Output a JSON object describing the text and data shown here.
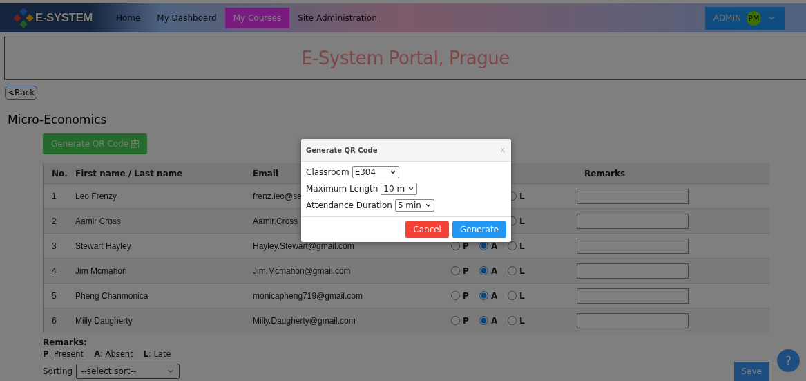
{
  "nav": {
    "logo": "E-SYSTEM",
    "items": [
      {
        "label": "Home",
        "selected": false
      },
      {
        "label": "My Dashboard",
        "selected": false
      },
      {
        "label": "My Courses",
        "selected": true
      },
      {
        "label": "Site Administration",
        "selected": false
      }
    ],
    "user": {
      "label": "ADMIN",
      "initials": "PM"
    }
  },
  "banner": {
    "title": "E-System Portal, Prague"
  },
  "back_button": "<Back",
  "course": {
    "title": "Micro-Economics",
    "qr_button": "Generate QR Code"
  },
  "table": {
    "columns": [
      "No.",
      "First name / Last name",
      "Email",
      "Remarks"
    ],
    "rows": [
      {
        "no": "1",
        "name": "Leo Frenzy",
        "email": "frenz.leo@se",
        "attendance": [
          {
            "label": "L",
            "selected": false
          }
        ]
      },
      {
        "no": "2",
        "name": "Aamir Cross",
        "email": "Aamir.Cross",
        "attendance": [
          {
            "label": "L",
            "selected": false
          }
        ]
      },
      {
        "no": "3",
        "name": "Stewart Hayley",
        "email": "Hayley.Stewart@gmail.com",
        "attendance": [
          {
            "label": "P",
            "selected": false
          },
          {
            "label": "A",
            "selected": true
          },
          {
            "label": "L",
            "selected": false
          }
        ]
      },
      {
        "no": "4",
        "name": "Jim Mcmahon",
        "email": "Jim.Mcmahon@gmail.com",
        "attendance": [
          {
            "label": "P",
            "selected": false
          },
          {
            "label": "A",
            "selected": true
          },
          {
            "label": "L",
            "selected": false
          }
        ]
      },
      {
        "no": "5",
        "name": "Pheng Chanmonica",
        "email": "monicapheng719@gmail.com",
        "attendance": [
          {
            "label": "P",
            "selected": false
          },
          {
            "label": "A",
            "selected": true
          },
          {
            "label": "L",
            "selected": false
          }
        ]
      },
      {
        "no": "6",
        "name": "Milly Daugherty",
        "email": "Milly.Daugherty@gmail.com",
        "attendance": [
          {
            "label": "P",
            "selected": false
          },
          {
            "label": "A",
            "selected": true
          },
          {
            "label": "L",
            "selected": false
          }
        ]
      }
    ]
  },
  "legend": {
    "title": "Remarks:",
    "items": [
      "**P**: Present",
      "**A**: Absent",
      "**L**: Late"
    ]
  },
  "sorting": {
    "label": "Sorting",
    "value": "--select sort--"
  },
  "save_button": "Save",
  "help_button": "?",
  "modal": {
    "title": "Generate QR Code",
    "close": "×",
    "fields": [
      {
        "label": "Classroom",
        "value": "E304"
      },
      {
        "label": "Maximum Length",
        "value": "10 m"
      },
      {
        "label": "Attendance Duration",
        "value": "5 min"
      }
    ],
    "buttons": [
      {
        "label": "Cancel",
        "kind": "danger"
      },
      {
        "label": "Generate",
        "kind": "primary"
      }
    ]
  }
}
